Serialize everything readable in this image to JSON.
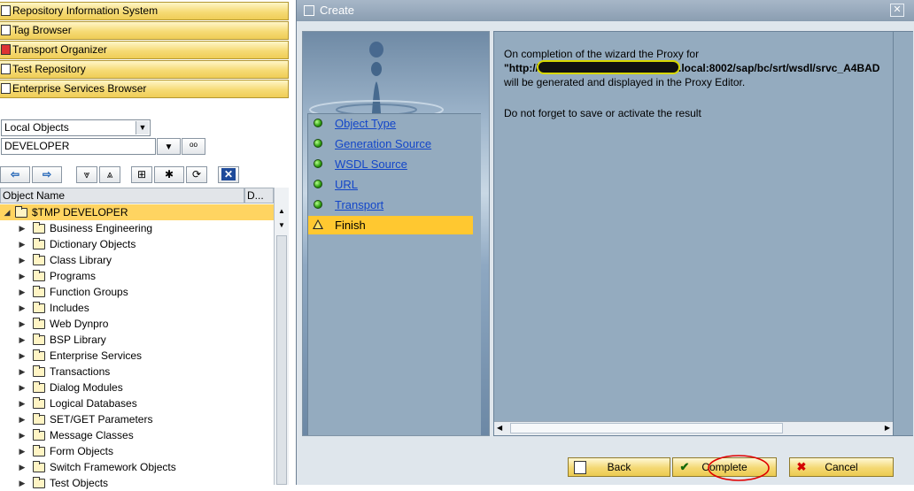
{
  "navigator": {
    "buttons": [
      {
        "label": "Repository Information System",
        "icon": "repository-icon"
      },
      {
        "label": "Tag Browser",
        "icon": "tag-icon"
      },
      {
        "label": "Transport Organizer",
        "icon": "truck-icon"
      },
      {
        "label": "Test Repository",
        "icon": "test-icon"
      },
      {
        "label": "Enterprise Services Browser",
        "icon": "services-icon"
      }
    ],
    "object_type_select": "Local Objects",
    "object_name_input": "DEVELOPER"
  },
  "tree": {
    "column_object_name": "Object Name",
    "column_description": "D...",
    "root": "$TMP DEVELOPER",
    "items": [
      "Business Engineering",
      "Dictionary Objects",
      "Class Library",
      "Programs",
      "Function Groups",
      "Includes",
      "Web Dynpro",
      "BSP Library",
      "Enterprise Services",
      "Transactions",
      "Dialog Modules",
      "Logical Databases",
      "SET/GET Parameters",
      "Message Classes",
      "Form Objects",
      "Switch Framework Objects",
      "Test Objects"
    ]
  },
  "dialog": {
    "title": "Create",
    "steps": [
      {
        "label": "Object Type",
        "status": "done"
      },
      {
        "label": "Generation Source",
        "status": "done"
      },
      {
        "label": "WSDL Source",
        "status": "done"
      },
      {
        "label": "URL",
        "status": "done"
      },
      {
        "label": "Transport",
        "status": "done"
      },
      {
        "label": "Finish",
        "status": "active"
      }
    ],
    "message_line1": "On completion of the wizard the Proxy for",
    "url_prefix": "\"http://",
    "url_suffix": ".local:8002/sap/bc/srt/wsdl/srvc_A4BAD",
    "message_line3": "will be generated and displayed in the Proxy Editor.",
    "message_line4": "Do not forget to save or activate the result",
    "buttons": {
      "back": "Back",
      "complete": "Complete",
      "cancel": "Cancel"
    }
  },
  "colors": {
    "nav_button": "#f6db76",
    "active_step": "#ffc830",
    "dialog_panel": "#94abbf",
    "link": "#1346c9",
    "highlight_annotation": "#e0e000",
    "circle_annotation": "#e00000"
  }
}
